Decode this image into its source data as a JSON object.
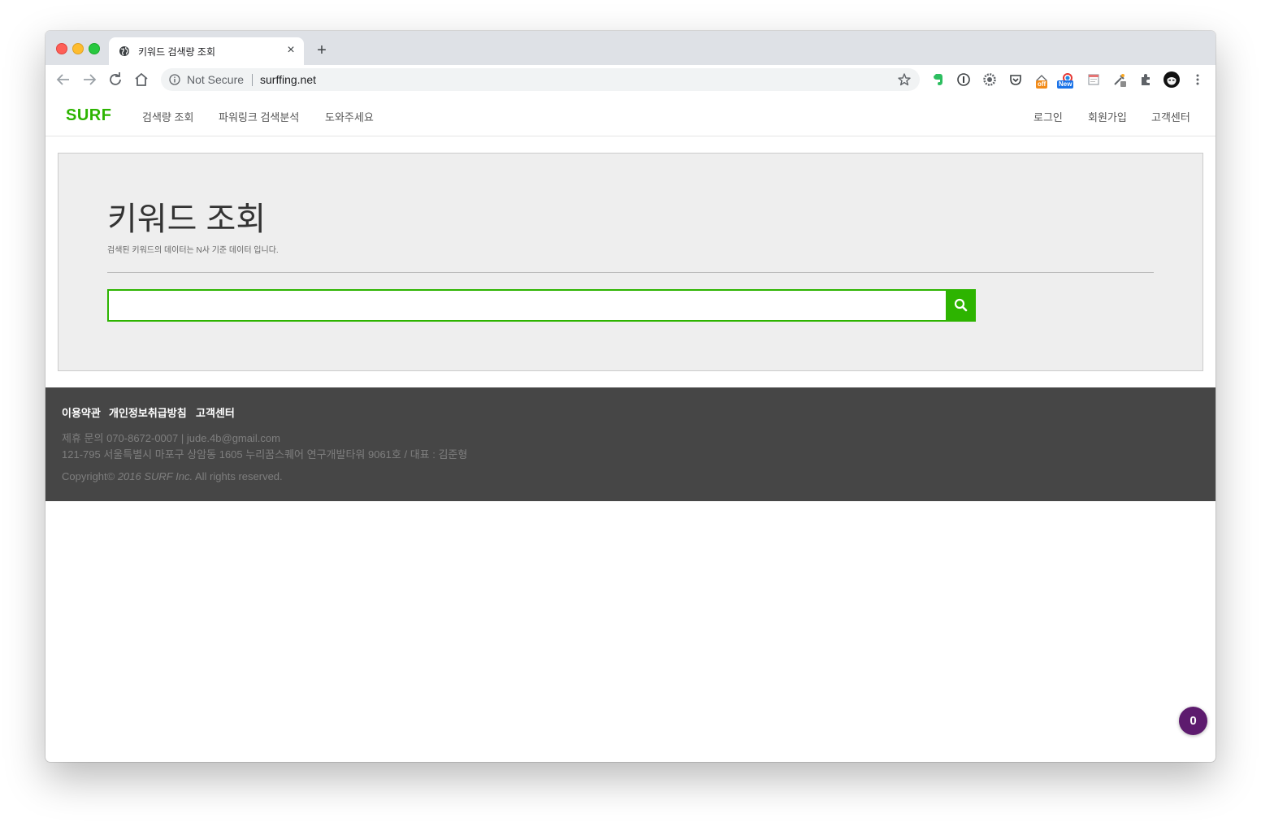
{
  "browser": {
    "tab_title": "키워드 검색량 조회",
    "tab_close": "×",
    "new_tab": "+",
    "not_secure": "Not Secure",
    "url": "surffing.net",
    "extension_badges": {
      "off": "off",
      "new": "New"
    }
  },
  "site": {
    "brand": "SURF",
    "nav": [
      "검색량 조회",
      "파워링크 검색분석",
      "도와주세요"
    ],
    "nav_right": [
      "로그인",
      "회원가입",
      "고객센터"
    ]
  },
  "main": {
    "title": "키워드 조회",
    "subtitle": "검색된 키워드의 데이터는 N사 기준 데이터 입니다.",
    "search": {
      "value": "",
      "placeholder": ""
    },
    "accent_color": "#2db400"
  },
  "footer": {
    "links": [
      "이용약관",
      "개인정보취급방침",
      "고객센터"
    ],
    "contact": "제휴 문의 070-8672-0007 | jude.4b@gmail.com",
    "address": "121-795 서울특별시 마포구 상암동 1605 누리꿈스퀘어 연구개발타워 9061호 / 대표 : 김준형",
    "copyright_prefix": "Copyright© ",
    "copyright_company": "2016 SURF Inc.",
    "copyright_suffix": " All rights reserved."
  },
  "floating_badge": "0",
  "icons": {
    "browser": [
      "globe-icon",
      "close-icon",
      "plus-icon",
      "back-icon",
      "forward-icon",
      "reload-icon",
      "home-icon",
      "info-icon",
      "star-icon",
      "evernote-icon",
      "onepassword-icon",
      "gear-extension-icon",
      "pocket-icon",
      "extension-off-icon",
      "extension-new-icon",
      "calendar-extension-icon",
      "eyedropper-icon",
      "puzzle-icon",
      "profile-avatar-icon",
      "more-menu-icon"
    ],
    "site": [
      "search-icon"
    ]
  }
}
